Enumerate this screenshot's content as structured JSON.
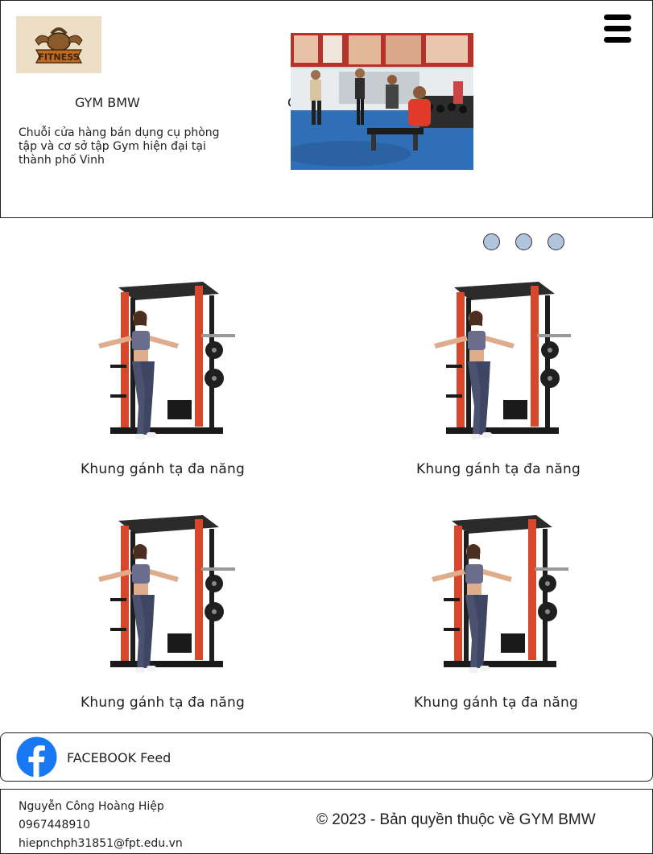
{
  "header": {
    "logo_text": "FITNESS",
    "brand": "GYM BMW",
    "stray_char": "C",
    "tagline": "Chuỗi cửa hàng bán dụng cụ phòng tập và cơ sở tập Gym hiện đại tại thành phố Vinh",
    "menu_icon": "hamburger-menu-icon"
  },
  "slider": {
    "dot_count": 3,
    "dot_color": "#b0c4de"
  },
  "products": [
    {
      "label": "Khung gánh tạ đa năng"
    },
    {
      "label": "Khung gánh tạ đa năng"
    },
    {
      "label": "Khung gánh tạ đa năng"
    },
    {
      "label": "Khung gánh tạ đa năng"
    }
  ],
  "facebook": {
    "icon": "facebook-icon",
    "label": "FACEBOOK Feed",
    "color": "#1877f2"
  },
  "footer": {
    "name": "Nguyễn Công Hoàng Hiệp",
    "phone": "0967448910",
    "email": "hiepnchph31851@fpt.edu.vn",
    "copyright": "© 2023 - Bản quyền thuộc về GYM BMW"
  }
}
